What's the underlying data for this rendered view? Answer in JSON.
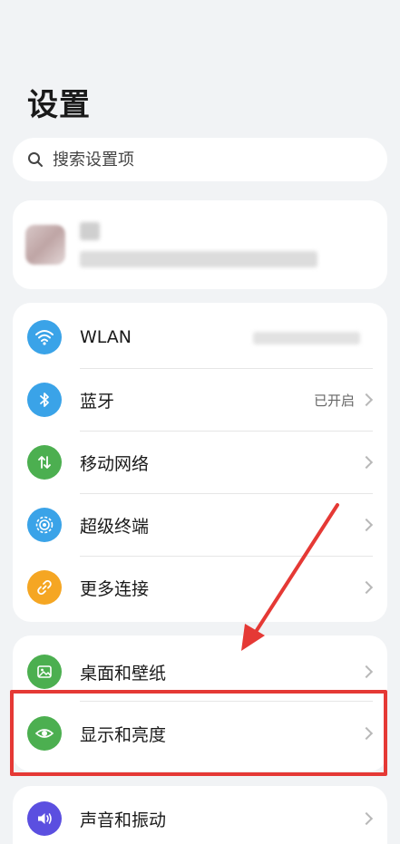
{
  "page": {
    "title": "设置"
  },
  "search": {
    "placeholder": "搜索设置项"
  },
  "connectivity": {
    "items": [
      {
        "label": "WLAN",
        "status": "",
        "icon": "wifi-icon",
        "color": "#3aa3e8"
      },
      {
        "label": "蓝牙",
        "status": "已开启",
        "icon": "bluetooth-icon",
        "color": "#3aa3e8"
      },
      {
        "label": "移动网络",
        "status": "",
        "icon": "mobile-network-icon",
        "color": "#4caf50"
      },
      {
        "label": "超级终端",
        "status": "",
        "icon": "super-device-icon",
        "color": "#3aa3e8"
      },
      {
        "label": "更多连接",
        "status": "",
        "icon": "link-icon",
        "color": "#f5a623"
      }
    ]
  },
  "display": {
    "items": [
      {
        "label": "桌面和壁纸",
        "icon": "wallpaper-icon",
        "color": "#4caf50"
      },
      {
        "label": "显示和亮度",
        "icon": "eye-icon",
        "color": "#4caf50"
      }
    ]
  },
  "sound": {
    "items": [
      {
        "label": "声音和振动",
        "icon": "speaker-icon",
        "color": "#5b4fe0"
      }
    ]
  },
  "annotation": {
    "color": "#e53935"
  }
}
